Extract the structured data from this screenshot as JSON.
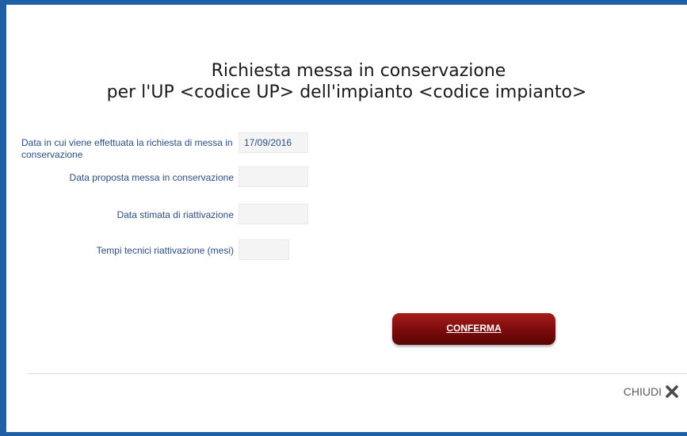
{
  "dialog": {
    "title_line1": "Richiesta messa in conservazione",
    "title_line2": "per l'UP <codice UP> dell'impianto <codice impianto>"
  },
  "form": {
    "request_date": {
      "label": "Data in cui viene effettuata la richiesta di messa in conservazione",
      "value": "17/09/2016"
    },
    "proposed_date": {
      "label": "Data proposta messa in conservazione",
      "value": ""
    },
    "reactivation_date": {
      "label": "Data stimata di riattivazione",
      "value": ""
    },
    "technical_time": {
      "label": "Tempi tecnici riattivazione (mesi)",
      "value": ""
    }
  },
  "actions": {
    "confirm_label": "CONFERMA",
    "close_label": "CHIUDI"
  },
  "icons": {
    "close": "close-icon"
  },
  "colors": {
    "frame": "#1f5fa6",
    "label_text": "#2b4f86",
    "confirm_button": "#7a0b0b"
  }
}
